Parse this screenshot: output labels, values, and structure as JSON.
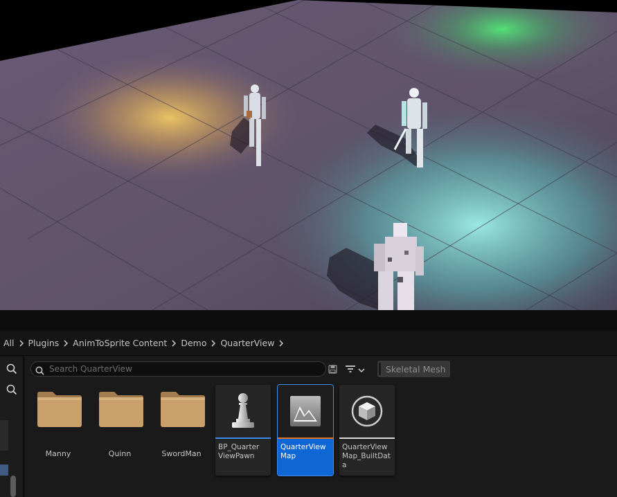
{
  "breadcrumb": {
    "items": [
      "All",
      "Plugins",
      "AnimToSprite Content",
      "Demo",
      "QuarterView"
    ]
  },
  "toolbar": {
    "search_placeholder": "Search QuarterView",
    "filter_chip": "Skeletal Mesh"
  },
  "folders": [
    {
      "name": "Manny",
      "icon": "folder-icon"
    },
    {
      "name": "Quinn",
      "icon": "folder-icon"
    },
    {
      "name": "SwordMan",
      "icon": "folder-icon"
    }
  ],
  "assets": [
    {
      "name": "BP_Quarter ViewPawn",
      "icon": "pawn-icon",
      "type_color": "#3d8bfd",
      "selected": false
    },
    {
      "name": "QuarterView Map",
      "icon": "map-icon",
      "type_color": "#e8711c",
      "selected": true
    },
    {
      "name": "QuarterView Map_BuiltData",
      "icon": "cube-icon",
      "type_color": "#dcdcdc",
      "selected": false
    }
  ],
  "colors": {
    "selection": "#0f67d6",
    "folder": "#c9a06b",
    "light_yellow": "#f0c060",
    "light_green": "#48e068",
    "light_cyan": "#8ee8e4"
  }
}
